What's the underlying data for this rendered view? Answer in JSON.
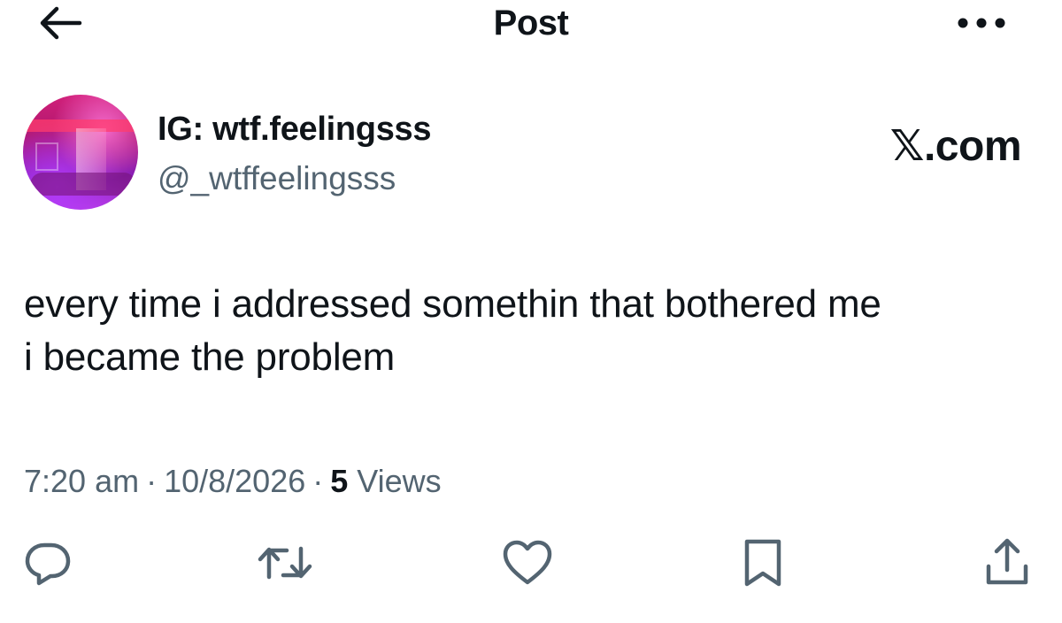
{
  "header": {
    "title": "Post",
    "back_icon": "arrow-left-icon",
    "more_icon": "more-horizontal-icon"
  },
  "author": {
    "display_name": "IG: wtf.feelingsss",
    "handle": "@_wtffeelingsss"
  },
  "watermark": "𝕏.com",
  "post": {
    "lines": [
      "every time i addressed somethin that bothered me",
      "i became the problem"
    ]
  },
  "meta": {
    "time": "7:20 am",
    "date": "10/8/2026",
    "separator": "·",
    "views_count": "5",
    "views_label": "Views"
  },
  "actions": {
    "reply_icon": "reply-icon",
    "repost_icon": "repost-icon",
    "like_icon": "heart-icon",
    "bookmark_icon": "bookmark-icon",
    "share_icon": "share-icon"
  },
  "colors": {
    "text_primary": "#0f1419",
    "text_secondary": "#536471",
    "icon": "#536471",
    "background": "#ffffff"
  }
}
